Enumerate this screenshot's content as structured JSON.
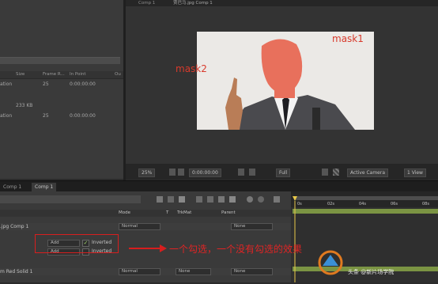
{
  "project": {
    "headers": {
      "size": "Size",
      "frame_rate": "Frame R...",
      "in_point": "In Point",
      "out_point": "Ou"
    },
    "rows": [
      {
        "name": "ation",
        "size": "",
        "fps": "25",
        "in": "0:00:00:00"
      },
      {
        "name": "",
        "size": "233 KB",
        "fps": "",
        "in": ""
      },
      {
        "name": "ation",
        "size": "",
        "fps": "25",
        "in": "0:00:00:00"
      }
    ]
  },
  "viewer": {
    "tab_comp": "Comp 1",
    "tab_layer": "贾巴马.jpg Comp 1",
    "mask1": "mask1",
    "mask2": "mask2",
    "zoom": "25%",
    "timecode": "0:00:00:00",
    "resolution": "Full",
    "camera": "Active Camera",
    "view": "1 View"
  },
  "timeline": {
    "tab_left": "Comp 1",
    "tab_active": "Comp 1",
    "col_mode": "Mode",
    "col_t": "T",
    "col_trkmat": "TrkMat",
    "col_parent": "Parent",
    "layer1_name": ".jpg Comp 1",
    "layer1_mode": "Normal",
    "layer1_parent": "None",
    "mask_a_mode": "Add",
    "mask_a_inverted": "Inverted",
    "mask_b_mode": "Add",
    "mask_b_inverted": "Inverted",
    "layer2_name": "m Red Solid 1",
    "layer2_mode": "Normal",
    "layer2_trkmat": "None",
    "layer2_parent": "None",
    "ruler": [
      "0s",
      "02s",
      "04s",
      "06s",
      "08s"
    ],
    "annotation": "一个勾选，一个没有勾选的效果",
    "watermark_author": "头条 @新片场学院"
  },
  "colors": {
    "annotation_red": "#d81e1e",
    "mask_fill": "#e8705c",
    "timeline_bar": "#7b9443"
  }
}
